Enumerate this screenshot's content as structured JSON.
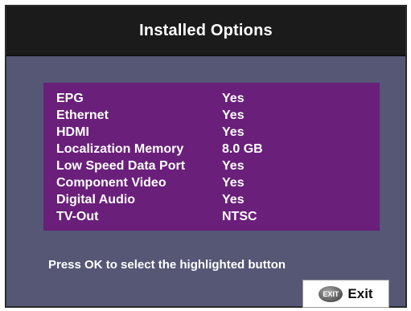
{
  "header": {
    "title": "Installed Options"
  },
  "options": [
    {
      "name": "EPG",
      "value": "Yes"
    },
    {
      "name": "Ethernet",
      "value": "Yes"
    },
    {
      "name": "HDMI",
      "value": "Yes"
    },
    {
      "name": "Localization Memory",
      "value": "8.0 GB"
    },
    {
      "name": "Low Speed Data Port",
      "value": "Yes"
    },
    {
      "name": "Component Video",
      "value": "Yes"
    },
    {
      "name": "Digital Audio",
      "value": "Yes"
    },
    {
      "name": "TV-Out",
      "value": "NTSC"
    }
  ],
  "footer": {
    "instructions": "Press OK to select the highlighted button",
    "exit_icon_text": "EXIT",
    "exit_label": "Exit"
  },
  "colors": {
    "screen_background": "#555775",
    "header_background": "#1b1b1b",
    "panel_background": "#6a1f7a",
    "text": "#ffffff"
  }
}
